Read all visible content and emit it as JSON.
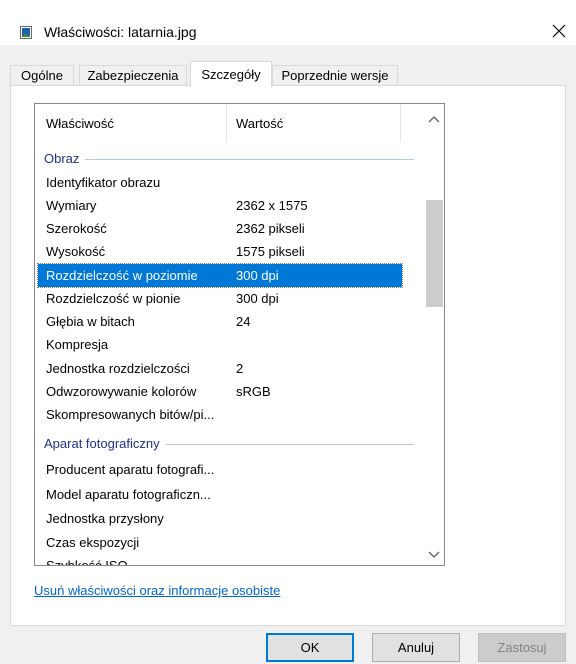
{
  "window": {
    "title": "Właściwości: latarnia.jpg",
    "icon": "image-file-icon",
    "close": "close-icon"
  },
  "tabs": [
    {
      "label": "Ogólne",
      "active": false
    },
    {
      "label": "Zabezpieczenia",
      "active": false
    },
    {
      "label": "Szczegóły",
      "active": true
    },
    {
      "label": "Poprzednie wersje",
      "active": false
    }
  ],
  "list": {
    "header": {
      "name": "Właściwość",
      "value": "Wartość"
    },
    "groups": [
      {
        "label": "Obraz",
        "rows": [
          {
            "name": "Identyfikator obrazu",
            "value": ""
          },
          {
            "name": "Wymiary",
            "value": "2362 x 1575"
          },
          {
            "name": "Szerokość",
            "value": "2362 pikseli"
          },
          {
            "name": "Wysokość",
            "value": "1575 pikseli"
          },
          {
            "name": "Rozdzielczość w poziomie",
            "value": "300 dpi",
            "selected": true
          },
          {
            "name": "Rozdzielczość w pionie",
            "value": "300 dpi"
          },
          {
            "name": "Głębia w bitach",
            "value": "24"
          },
          {
            "name": "Kompresja",
            "value": ""
          },
          {
            "name": "Jednostka rozdzielczości",
            "value": "2"
          },
          {
            "name": "Odwzorowywanie kolorów",
            "value": "sRGB"
          },
          {
            "name": "Skompresowanych bitów/pi...",
            "value": ""
          }
        ]
      },
      {
        "label": "Aparat fotograficzny",
        "rows": [
          {
            "name": "Producent aparatu fotografi...",
            "value": ""
          },
          {
            "name": "Model aparatu fotograficzn...",
            "value": ""
          },
          {
            "name": "Jednostka przysłony",
            "value": ""
          },
          {
            "name": "Czas ekspozycji",
            "value": ""
          },
          {
            "name": "Szybkość ISO",
            "value": ""
          }
        ]
      }
    ]
  },
  "link_label": "Usuń właściwości oraz informacje osobiste",
  "buttons": {
    "ok": "OK",
    "cancel": "Anuluj",
    "apply": "Zastosuj"
  },
  "colors": {
    "selection": "#0078d7",
    "group_header": "#1e3287",
    "link": "#0066cc"
  }
}
